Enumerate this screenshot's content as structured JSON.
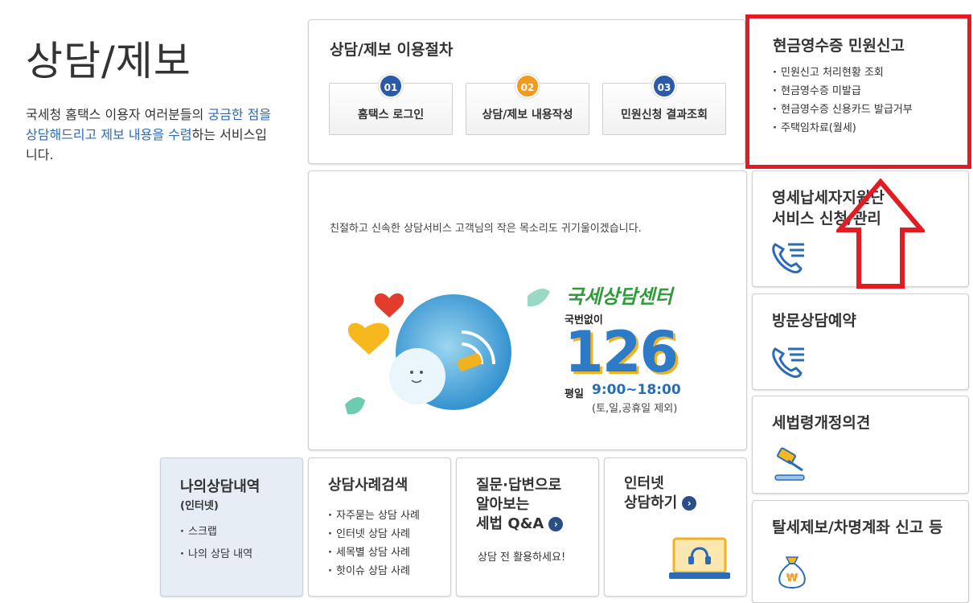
{
  "page": {
    "title": "상담/제보",
    "desc_part1": "국세청 홈택스 이용자 여러분들의 ",
    "desc_hl1": "궁금한 점을 상담해드리고 제보 내용을 수렴",
    "desc_part2": "하는 서비스입니다."
  },
  "procedure": {
    "title": "상담/제보 이용절차",
    "steps": [
      {
        "num": "01",
        "label": "홈택스 로그인",
        "color": "#2a5aa8"
      },
      {
        "num": "02",
        "label": "상담/제보 내용작성",
        "color": "#f39a1e"
      },
      {
        "num": "03",
        "label": "민원신청 결과조회",
        "color": "#2a5aa8"
      }
    ]
  },
  "cash_receipt": {
    "title": "현금영수증 민원신고",
    "items": [
      "민원신고 처리현황 조회",
      "현금영수증 미발급",
      "현금영수증 신용카드 발급거부",
      "주택임차료(월세)"
    ]
  },
  "banner": {
    "tagline": "친절하고 신속한 상담서비스 고객님의 작은 목소리도 귀기울이겠습니다.",
    "center_name": "국세상담센터",
    "toll_label": "국번없이",
    "tel_number": "126",
    "hours_label": "평일",
    "hours_time": "9:00~18:00",
    "hours_note": "(토,일,공휴일 제외)"
  },
  "right_cards": {
    "small_taxpayer": {
      "line1": "영세납세자지원단",
      "line2": "서비스 신청/관리",
      "icon": "phone-icon"
    },
    "visit": {
      "title": "방문상담예약",
      "icon": "phone-icon"
    },
    "tax_law": {
      "title": "세법령개정의견",
      "icon": "gavel-icon"
    },
    "report": {
      "title": "탈세제보/차명계좌 신고 등",
      "icon": "money-bag-icon"
    }
  },
  "bottom": {
    "my_history": {
      "title": "나의상담내역",
      "sub": "(인터넷)",
      "items": [
        "스크랩",
        "나의 상담 내역"
      ]
    },
    "case_search": {
      "title": "상담사례검색",
      "items": [
        "자주묻는 상담 사례",
        "인터넷 상담 사례",
        "세목별 상담 사례",
        "핫이슈 상담 사례"
      ]
    },
    "qa": {
      "line1": "질문·답변으로",
      "line2": "알아보는",
      "line3": "세법 Q&A",
      "note": "상담 전 활용하세요!"
    },
    "internet": {
      "line1": "인터넷",
      "line2": "상담하기"
    }
  },
  "colors": {
    "accent_blue": "#2a6bb8",
    "alert_red": "#e31b23",
    "step_orange": "#f39a1e"
  }
}
